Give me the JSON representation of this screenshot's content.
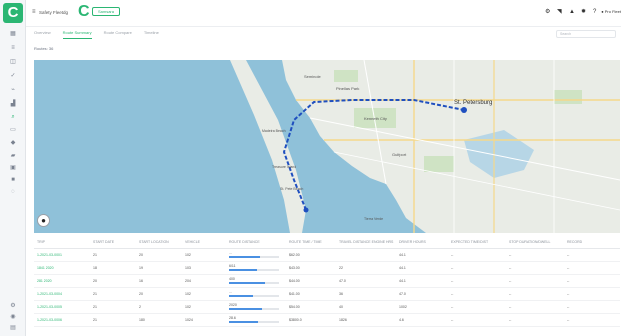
{
  "rail": {
    "logo": "C",
    "icons": [
      "grid-icon",
      "list-icon",
      "layers-icon",
      "check-icon",
      "route-icon",
      "chart-icon",
      "search-icon",
      "calendar-icon",
      "pin-icon",
      "truck-icon",
      "clipboard-icon",
      "box-icon",
      "alert-icon",
      "settings-icon",
      "help-icon"
    ]
  },
  "header": {
    "dashboard_name": "Safety Fleetdg",
    "brand_letter": "C",
    "brand_box": "Samsara",
    "user": "Pro Fleet"
  },
  "tabs": [
    "Overview",
    "Route Summary",
    "Route Compare",
    "Timeline"
  ],
  "active_tab_index": 1,
  "search": {
    "placeholder": "Search"
  },
  "filter": {
    "label": "Routes: 36"
  },
  "map": {
    "labels": [
      "St. Petersburg",
      "Pinellas Park",
      "Kenneth City",
      "Gulfport",
      "Treasure Island",
      "St. Pete Beach",
      "Madeira Beach",
      "Seminole",
      "Tierra Verde"
    ]
  },
  "table": {
    "columns": [
      "TRIP",
      "START DATE",
      "START LOCATION",
      "VEHICLE",
      "ROUTE DISTANCE",
      "ROUTE TIME / TIME",
      "TRAVEL DISTANCE ENGINE HRS",
      "DRIVER HOURS",
      "EXPECTED TIME/DIST",
      "STOP DURATION/DWELL",
      "RECORD"
    ],
    "rows": [
      {
        "trip": "1-2021-03-0001",
        "c2": "21",
        "c3": "20",
        "c4": "102",
        "c5": "...",
        "bar": 0.62,
        "c6": "$62.00",
        "c7": "",
        "c8": "44.1",
        "c9": "--",
        "c10": "--",
        "c11": "--"
      },
      {
        "trip": "1841 2020",
        "c2": "18",
        "c3": "19",
        "c4": "103",
        "c5": "6/11",
        "bar": 0.55,
        "c6": "$43.00",
        "c7": "22",
        "c8": "44.1",
        "c9": "--",
        "c10": "--",
        "c11": "--"
      },
      {
        "trip": "281 2020",
        "c2": "20",
        "c3": "16",
        "c4": "204",
        "c5": "400",
        "bar": 0.71,
        "c6": "$44.00",
        "c7": "47.0",
        "c8": "44.1",
        "c9": "--",
        "c10": "--",
        "c11": "--"
      },
      {
        "trip": "1-2021-03-0004",
        "c2": "21",
        "c3": "20",
        "c4": "102",
        "c5": "...",
        "bar": 0.48,
        "c6": "$41.00",
        "c7": "36",
        "c8": "47.0",
        "c9": "--",
        "c10": "--",
        "c11": "--"
      },
      {
        "trip": "1-2021-03-0005",
        "c2": "21",
        "c3": "2",
        "c4": "102",
        "c5": "2020",
        "bar": 0.66,
        "c6": "$54.00",
        "c7": "40",
        "c8": "1002",
        "c9": "--",
        "c10": "--",
        "c11": "--"
      },
      {
        "trip": "1-2021-03-0006",
        "c2": "21",
        "c3": "180",
        "c4": "1024",
        "c5": "28.6",
        "bar": 0.58,
        "c6": "$3800.0",
        "c7": "1826",
        "c8": "4.6",
        "c9": "--",
        "c10": "--",
        "c11": "--"
      }
    ]
  },
  "colors": {
    "accent": "#2bb673",
    "route": "#1f4fbf",
    "water": "#8fc1d9",
    "land": "#e9ece6"
  }
}
